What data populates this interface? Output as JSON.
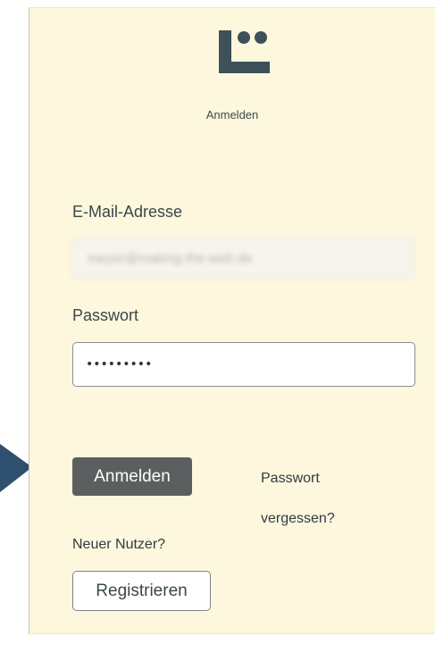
{
  "login": {
    "caption": "Anmelden",
    "email_label": "E-Mail-Adresse",
    "email_value": "meyer@making-the-web.de",
    "password_label": "Passwort",
    "password_value": "•••••••••",
    "submit_label": "Anmelden",
    "forgot_link_label": "Passwort vergessen?",
    "new_user_text": "Neuer Nutzer?",
    "register_label": "Registrieren"
  },
  "icons": {
    "logo": "brand-logo-icon",
    "arrow": "pointer-arrow-icon"
  },
  "colors": {
    "panel_background": "#fdf7de",
    "logo_color": "#3e5058",
    "primary_button": "#5b5f5f",
    "arrow": "#2f4f6e",
    "text": "#3b474a"
  }
}
